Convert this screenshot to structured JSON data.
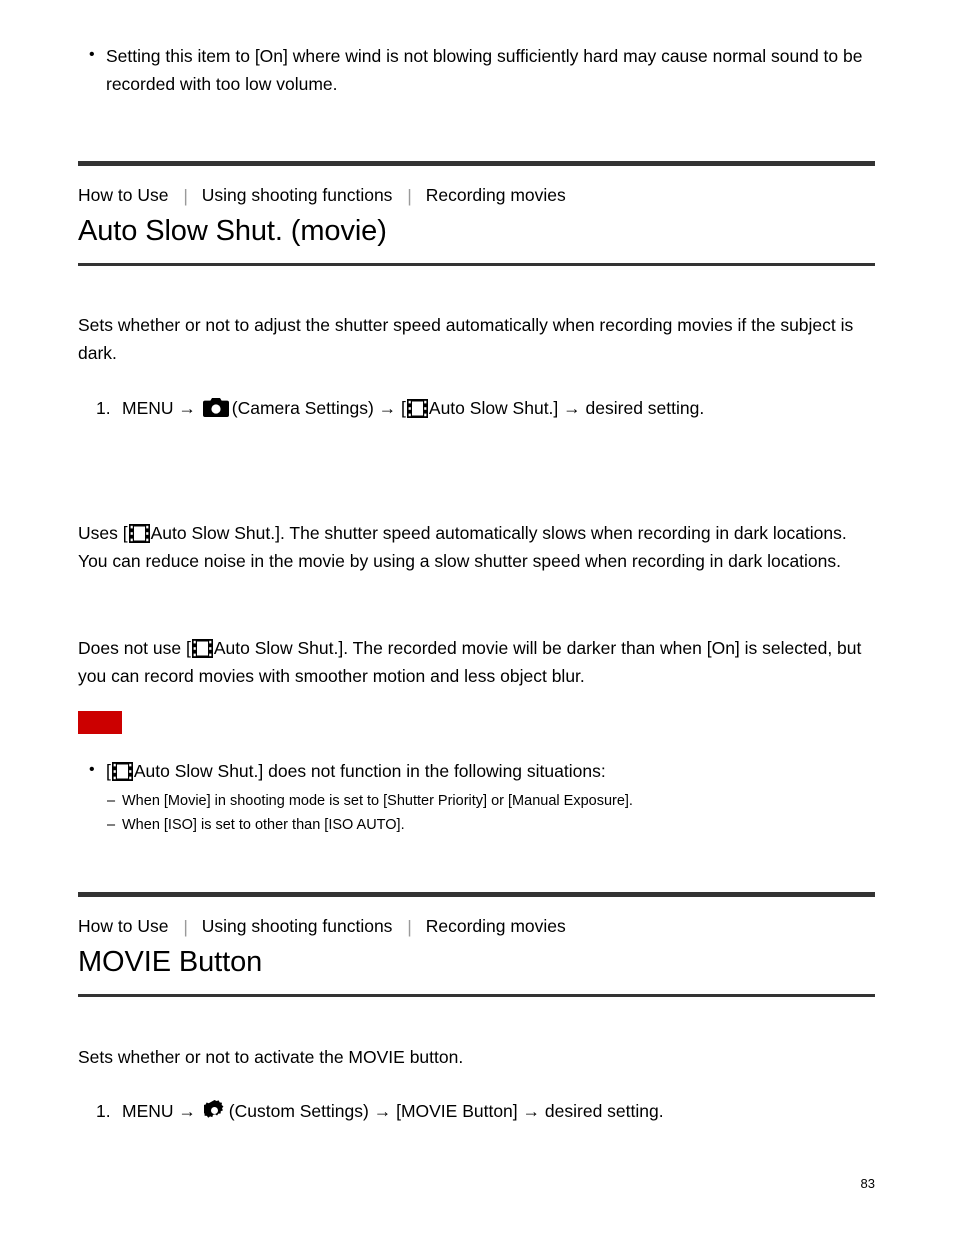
{
  "document": {
    "page_number": "83",
    "rule_color": "#333333",
    "note_marker_color": "#cc0000"
  },
  "top_note": {
    "bullets": [
      "Setting this item to [On] where wind is not blowing sufficiently hard may cause normal sound to be recorded with too low volume."
    ]
  },
  "sections": [
    {
      "breadcrumb": [
        "How to Use",
        "Using shooting functions",
        "Recording movies"
      ],
      "title": "Auto Slow Shut. (movie)",
      "intro": "Sets whether or not to adjust the shutter speed automatically when recording movies if the subject is dark.",
      "step": {
        "number": "1.",
        "menu_label": "MENU",
        "arrow": "→",
        "icon1": "camera-icon",
        "group_label": "(Camera Settings)",
        "arrow2": "→",
        "bracket_open": "[",
        "icon2": "film-icon",
        "item_label": "Auto Slow Shut.]",
        "arrow3": "→",
        "tail_label": "desired setting."
      },
      "descriptions": [
        {
          "lead": "Uses [",
          "icon": "film-icon",
          "body": "Auto Slow Shut.]. The shutter speed automatically slows when recording in dark locations. You can reduce noise in the movie by using a slow shutter speed when recording in dark locations."
        },
        {
          "lead": "Does not use [",
          "icon": "film-icon",
          "body": "Auto Slow Shut.]. The recorded movie will be darker than when [On] is selected, but you can record movies with smoother motion and less object blur."
        }
      ],
      "note": {
        "marker": "",
        "bullet": {
          "lead": "[",
          "icon": "film-icon",
          "body": "Auto Slow Shut.] does not function in the following situations:"
        },
        "subitems": [
          "When [Movie] in shooting mode is set to [Shutter Priority] or [Manual Exposure].",
          "When [ISO] is set to other than [ISO AUTO]."
        ]
      }
    },
    {
      "breadcrumb": [
        "How to Use",
        "Using shooting functions",
        "Recording movies"
      ],
      "title": "MOVIE Button",
      "intro": "Sets whether or not to activate the MOVIE button.",
      "step": {
        "number": "1.",
        "menu_label": "MENU",
        "arrow": "→",
        "icon1": "gear-icon",
        "group_label": "(Custom Settings)",
        "arrow2": "→",
        "item_label": "[MOVIE Button]",
        "arrow3": "→",
        "tail_label": "desired setting."
      }
    }
  ]
}
